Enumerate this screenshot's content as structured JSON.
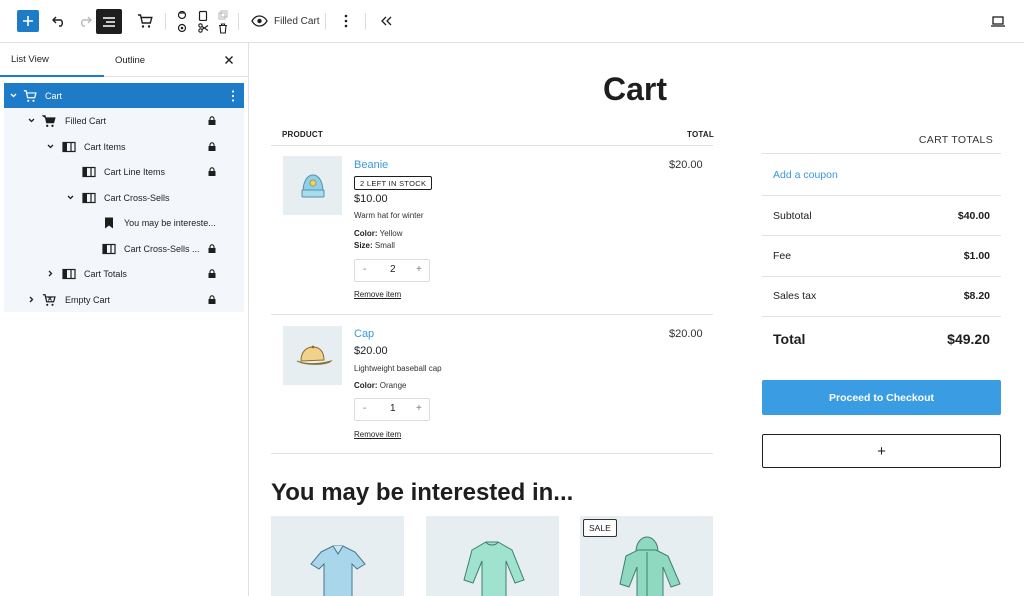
{
  "toolbar": {
    "document_view_label": "Filled Cart"
  },
  "sidebar": {
    "tabs": [
      {
        "label": "List View"
      },
      {
        "label": "Outline"
      }
    ],
    "items": [
      {
        "label": "Cart"
      },
      {
        "label": "Filled Cart"
      },
      {
        "label": "Cart Items"
      },
      {
        "label": "Cart Line Items"
      },
      {
        "label": "Cart Cross-Sells"
      },
      {
        "label": "You may be intereste..."
      },
      {
        "label": "Cart Cross-Sells ..."
      },
      {
        "label": "Cart Totals"
      },
      {
        "label": "Empty Cart"
      }
    ]
  },
  "cart": {
    "title": "Cart",
    "headers": {
      "product": "PRODUCT",
      "total": "TOTAL"
    },
    "items": [
      {
        "name": "Beanie",
        "stock_badge": "2 LEFT IN STOCK",
        "price": "$10.00",
        "description": "Warm hat for winter",
        "attrs": [
          {
            "key": "Color:",
            "value": "Yellow"
          },
          {
            "key": "Size:",
            "value": "Small"
          }
        ],
        "qty": {
          "minus": "-",
          "value": "2",
          "plus": "+"
        },
        "remove": "Remove item",
        "line_total": "$20.00"
      },
      {
        "name": "Cap",
        "price": "$20.00",
        "description": "Lightweight baseball cap",
        "attrs": [
          {
            "key": "Color:",
            "value": "Orange"
          }
        ],
        "qty": {
          "minus": "-",
          "value": "1",
          "plus": "+"
        },
        "remove": "Remove item",
        "line_total": "$20.00"
      }
    ],
    "cross_sells": {
      "title": "You may be interested in...",
      "sale_badge": "SALE"
    }
  },
  "totals": {
    "heading": "CART TOTALS",
    "coupon": "Add a coupon",
    "rows": [
      {
        "label": "Subtotal",
        "value": "$40.00"
      },
      {
        "label": "Fee",
        "value": "$1.00"
      },
      {
        "label": "Sales tax",
        "value": "$8.20"
      }
    ],
    "total": {
      "label": "Total",
      "value": "$49.20"
    },
    "checkout": "Proceed to Checkout",
    "add_block": "+"
  }
}
